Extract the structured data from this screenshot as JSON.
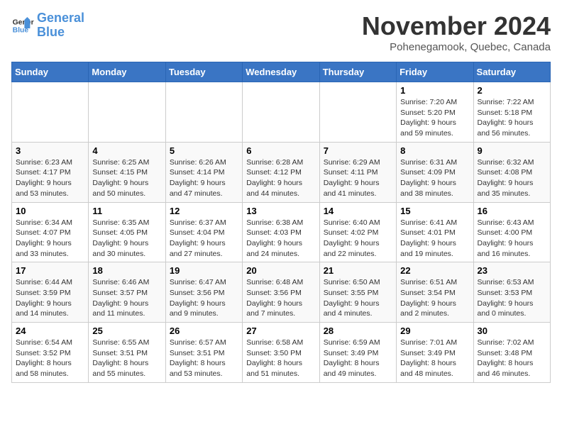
{
  "logo": {
    "line1": "General",
    "line2": "Blue"
  },
  "title": "November 2024",
  "location": "Pohenegamook, Quebec, Canada",
  "days_of_week": [
    "Sunday",
    "Monday",
    "Tuesday",
    "Wednesday",
    "Thursday",
    "Friday",
    "Saturday"
  ],
  "weeks": [
    [
      {
        "day": "",
        "info": ""
      },
      {
        "day": "",
        "info": ""
      },
      {
        "day": "",
        "info": ""
      },
      {
        "day": "",
        "info": ""
      },
      {
        "day": "",
        "info": ""
      },
      {
        "day": "1",
        "info": "Sunrise: 7:20 AM\nSunset: 5:20 PM\nDaylight: 9 hours and 59 minutes."
      },
      {
        "day": "2",
        "info": "Sunrise: 7:22 AM\nSunset: 5:18 PM\nDaylight: 9 hours and 56 minutes."
      }
    ],
    [
      {
        "day": "3",
        "info": "Sunrise: 6:23 AM\nSunset: 4:17 PM\nDaylight: 9 hours and 53 minutes."
      },
      {
        "day": "4",
        "info": "Sunrise: 6:25 AM\nSunset: 4:15 PM\nDaylight: 9 hours and 50 minutes."
      },
      {
        "day": "5",
        "info": "Sunrise: 6:26 AM\nSunset: 4:14 PM\nDaylight: 9 hours and 47 minutes."
      },
      {
        "day": "6",
        "info": "Sunrise: 6:28 AM\nSunset: 4:12 PM\nDaylight: 9 hours and 44 minutes."
      },
      {
        "day": "7",
        "info": "Sunrise: 6:29 AM\nSunset: 4:11 PM\nDaylight: 9 hours and 41 minutes."
      },
      {
        "day": "8",
        "info": "Sunrise: 6:31 AM\nSunset: 4:09 PM\nDaylight: 9 hours and 38 minutes."
      },
      {
        "day": "9",
        "info": "Sunrise: 6:32 AM\nSunset: 4:08 PM\nDaylight: 9 hours and 35 minutes."
      }
    ],
    [
      {
        "day": "10",
        "info": "Sunrise: 6:34 AM\nSunset: 4:07 PM\nDaylight: 9 hours and 33 minutes."
      },
      {
        "day": "11",
        "info": "Sunrise: 6:35 AM\nSunset: 4:05 PM\nDaylight: 9 hours and 30 minutes."
      },
      {
        "day": "12",
        "info": "Sunrise: 6:37 AM\nSunset: 4:04 PM\nDaylight: 9 hours and 27 minutes."
      },
      {
        "day": "13",
        "info": "Sunrise: 6:38 AM\nSunset: 4:03 PM\nDaylight: 9 hours and 24 minutes."
      },
      {
        "day": "14",
        "info": "Sunrise: 6:40 AM\nSunset: 4:02 PM\nDaylight: 9 hours and 22 minutes."
      },
      {
        "day": "15",
        "info": "Sunrise: 6:41 AM\nSunset: 4:01 PM\nDaylight: 9 hours and 19 minutes."
      },
      {
        "day": "16",
        "info": "Sunrise: 6:43 AM\nSunset: 4:00 PM\nDaylight: 9 hours and 16 minutes."
      }
    ],
    [
      {
        "day": "17",
        "info": "Sunrise: 6:44 AM\nSunset: 3:59 PM\nDaylight: 9 hours and 14 minutes."
      },
      {
        "day": "18",
        "info": "Sunrise: 6:46 AM\nSunset: 3:57 PM\nDaylight: 9 hours and 11 minutes."
      },
      {
        "day": "19",
        "info": "Sunrise: 6:47 AM\nSunset: 3:56 PM\nDaylight: 9 hours and 9 minutes."
      },
      {
        "day": "20",
        "info": "Sunrise: 6:48 AM\nSunset: 3:56 PM\nDaylight: 9 hours and 7 minutes."
      },
      {
        "day": "21",
        "info": "Sunrise: 6:50 AM\nSunset: 3:55 PM\nDaylight: 9 hours and 4 minutes."
      },
      {
        "day": "22",
        "info": "Sunrise: 6:51 AM\nSunset: 3:54 PM\nDaylight: 9 hours and 2 minutes."
      },
      {
        "day": "23",
        "info": "Sunrise: 6:53 AM\nSunset: 3:53 PM\nDaylight: 9 hours and 0 minutes."
      }
    ],
    [
      {
        "day": "24",
        "info": "Sunrise: 6:54 AM\nSunset: 3:52 PM\nDaylight: 8 hours and 58 minutes."
      },
      {
        "day": "25",
        "info": "Sunrise: 6:55 AM\nSunset: 3:51 PM\nDaylight: 8 hours and 55 minutes."
      },
      {
        "day": "26",
        "info": "Sunrise: 6:57 AM\nSunset: 3:51 PM\nDaylight: 8 hours and 53 minutes."
      },
      {
        "day": "27",
        "info": "Sunrise: 6:58 AM\nSunset: 3:50 PM\nDaylight: 8 hours and 51 minutes."
      },
      {
        "day": "28",
        "info": "Sunrise: 6:59 AM\nSunset: 3:49 PM\nDaylight: 8 hours and 49 minutes."
      },
      {
        "day": "29",
        "info": "Sunrise: 7:01 AM\nSunset: 3:49 PM\nDaylight: 8 hours and 48 minutes."
      },
      {
        "day": "30",
        "info": "Sunrise: 7:02 AM\nSunset: 3:48 PM\nDaylight: 8 hours and 46 minutes."
      }
    ]
  ]
}
